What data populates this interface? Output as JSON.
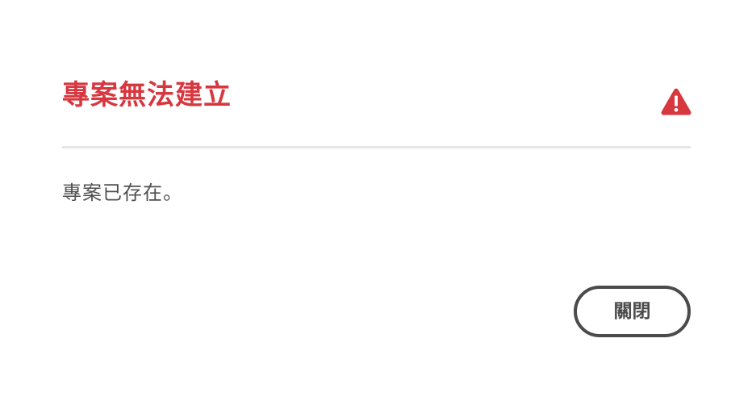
{
  "dialog": {
    "title": "專案無法建立",
    "message": "專案已存在。",
    "icon": "alert-icon",
    "close_button_label": "關閉"
  },
  "colors": {
    "title": "#d7373f",
    "icon": "#d7373f",
    "icon_mark": "#ffffff",
    "message": "#505050",
    "divider": "#e6e6e6",
    "button_border": "#4b4b4b",
    "button_text": "#4b4b4b",
    "background": "#ffffff"
  }
}
